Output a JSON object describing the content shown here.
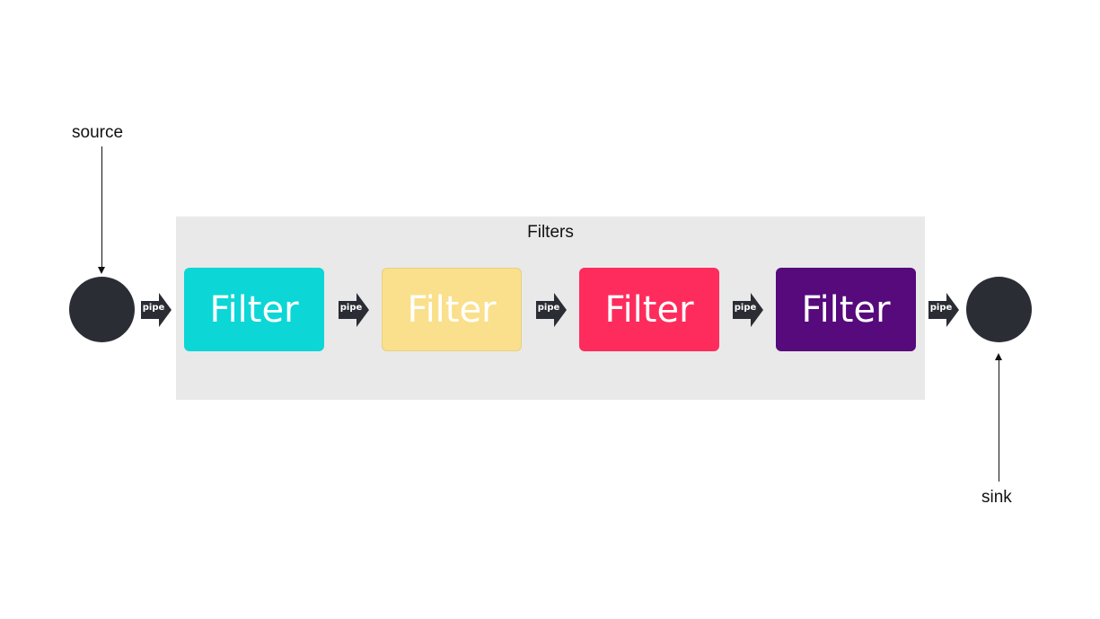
{
  "group": {
    "title": "Filters",
    "background": "#e9e9e9"
  },
  "source": {
    "label": "source",
    "color": "#2b2d35"
  },
  "sink": {
    "label": "sink",
    "color": "#2b2d35"
  },
  "filters": [
    {
      "label": "Filter",
      "color": "#0dd6d6"
    },
    {
      "label": "Filter",
      "color": "#fae08c"
    },
    {
      "label": "Filter",
      "color": "#fe2c5c"
    },
    {
      "label": "Filter",
      "color": "#560a7b"
    }
  ],
  "pipes": [
    {
      "label": "pipe"
    },
    {
      "label": "pipe"
    },
    {
      "label": "pipe"
    },
    {
      "label": "pipe"
    },
    {
      "label": "pipe"
    }
  ],
  "pipe_color": "#2b2d35"
}
